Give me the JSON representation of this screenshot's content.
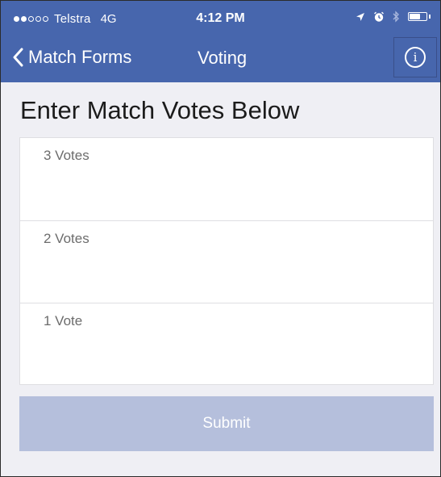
{
  "status_bar": {
    "carrier": "Telstra",
    "network": "4G",
    "time": "4:12 PM"
  },
  "navbar": {
    "back_label": "Match Forms",
    "title": "Voting",
    "info_label": "i"
  },
  "heading": "Enter Match Votes Below",
  "fields": [
    {
      "placeholder": "3 Votes",
      "value": ""
    },
    {
      "placeholder": "2 Votes",
      "value": ""
    },
    {
      "placeholder": "1 Vote",
      "value": ""
    }
  ],
  "submit_label": "Submit",
  "colors": {
    "nav_blue": "#4766ad",
    "submit_disabled": "#b5bfdc",
    "background": "#efeff4"
  }
}
